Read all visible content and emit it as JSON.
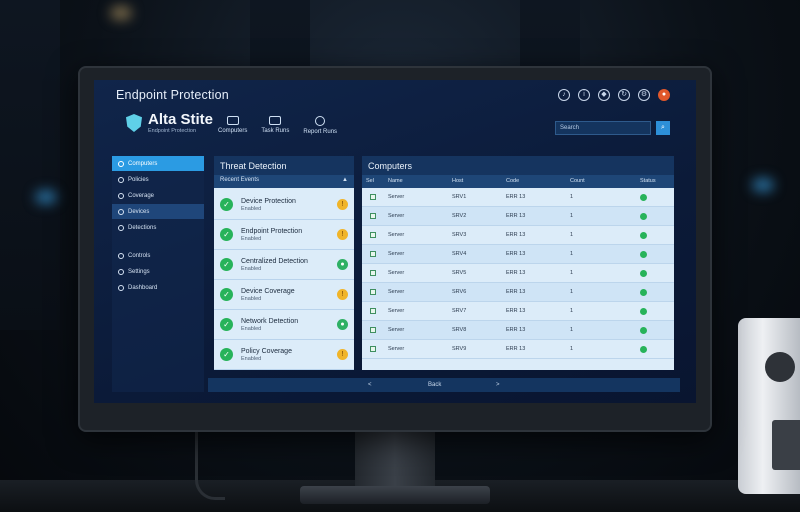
{
  "app": {
    "title": "Endpoint Protection",
    "brand_name": "Alta Stite",
    "brand_sub": "Endpoint Protection"
  },
  "header": {
    "nav": [
      {
        "label": "Computers",
        "icon": "monitor-icon"
      },
      {
        "label": "Task Runs",
        "icon": "lock-icon"
      },
      {
        "label": "Report Runs",
        "icon": "globe-icon"
      }
    ],
    "search_value": "Search",
    "top_icons": [
      "bell-icon",
      "info-icon",
      "user-icon",
      "refresh-icon",
      "settings-icon",
      "profile-icon"
    ]
  },
  "sidebar": {
    "items": [
      {
        "label": "Computers",
        "active": true
      },
      {
        "label": "Policies",
        "active": false
      },
      {
        "label": "Coverage",
        "active": false
      },
      {
        "label": "Devices",
        "active": false,
        "highlight": true
      },
      {
        "label": "Detections",
        "active": false
      }
    ],
    "secondary": [
      {
        "label": "Controls"
      },
      {
        "label": "Settings"
      },
      {
        "label": "Dashboard"
      }
    ]
  },
  "detections": {
    "title": "Threat Detection",
    "sub_label": "Recent Events",
    "items": [
      {
        "name": "Device Protection",
        "status": "Enabled",
        "alert": "warning"
      },
      {
        "name": "Endpoint Protection",
        "status": "Enabled",
        "alert": "warning"
      },
      {
        "name": "Centralized Detection",
        "status": "Enabled",
        "alert": "ok"
      },
      {
        "name": "Device Coverage",
        "status": "Enabled",
        "alert": "warning"
      },
      {
        "name": "Network Detection",
        "status": "Enabled",
        "alert": "ok"
      },
      {
        "name": "Policy Coverage",
        "status": "Enabled",
        "alert": "warning"
      }
    ]
  },
  "computers": {
    "title": "Computers",
    "columns": [
      "Sel",
      "Name",
      "Host",
      "Code",
      "Count",
      "Status"
    ],
    "rows": [
      {
        "name": "Server",
        "id": "SRV1",
        "code": "ERR 13",
        "count": "1"
      },
      {
        "name": "Server",
        "id": "SRV2",
        "code": "ERR 13",
        "count": "1"
      },
      {
        "name": "Server",
        "id": "SRV3",
        "code": "ERR 13",
        "count": "1"
      },
      {
        "name": "Server",
        "id": "SRV4",
        "code": "ERR 13",
        "count": "1"
      },
      {
        "name": "Server",
        "id": "SRV5",
        "code": "ERR 13",
        "count": "1"
      },
      {
        "name": "Server",
        "id": "SRV6",
        "code": "ERR 13",
        "count": "1"
      },
      {
        "name": "Server",
        "id": "SRV7",
        "code": "ERR 13",
        "count": "1"
      },
      {
        "name": "Server",
        "id": "SRV8",
        "code": "ERR 13",
        "count": "1"
      },
      {
        "name": "Server",
        "id": "SRV9",
        "code": "ERR 13",
        "count": "1"
      }
    ]
  },
  "footer": {
    "prev": "<",
    "page": "Back",
    "next": ">"
  },
  "colors": {
    "accent": "#2b9be3",
    "ok": "#27b35a",
    "warning": "#f0b429"
  }
}
